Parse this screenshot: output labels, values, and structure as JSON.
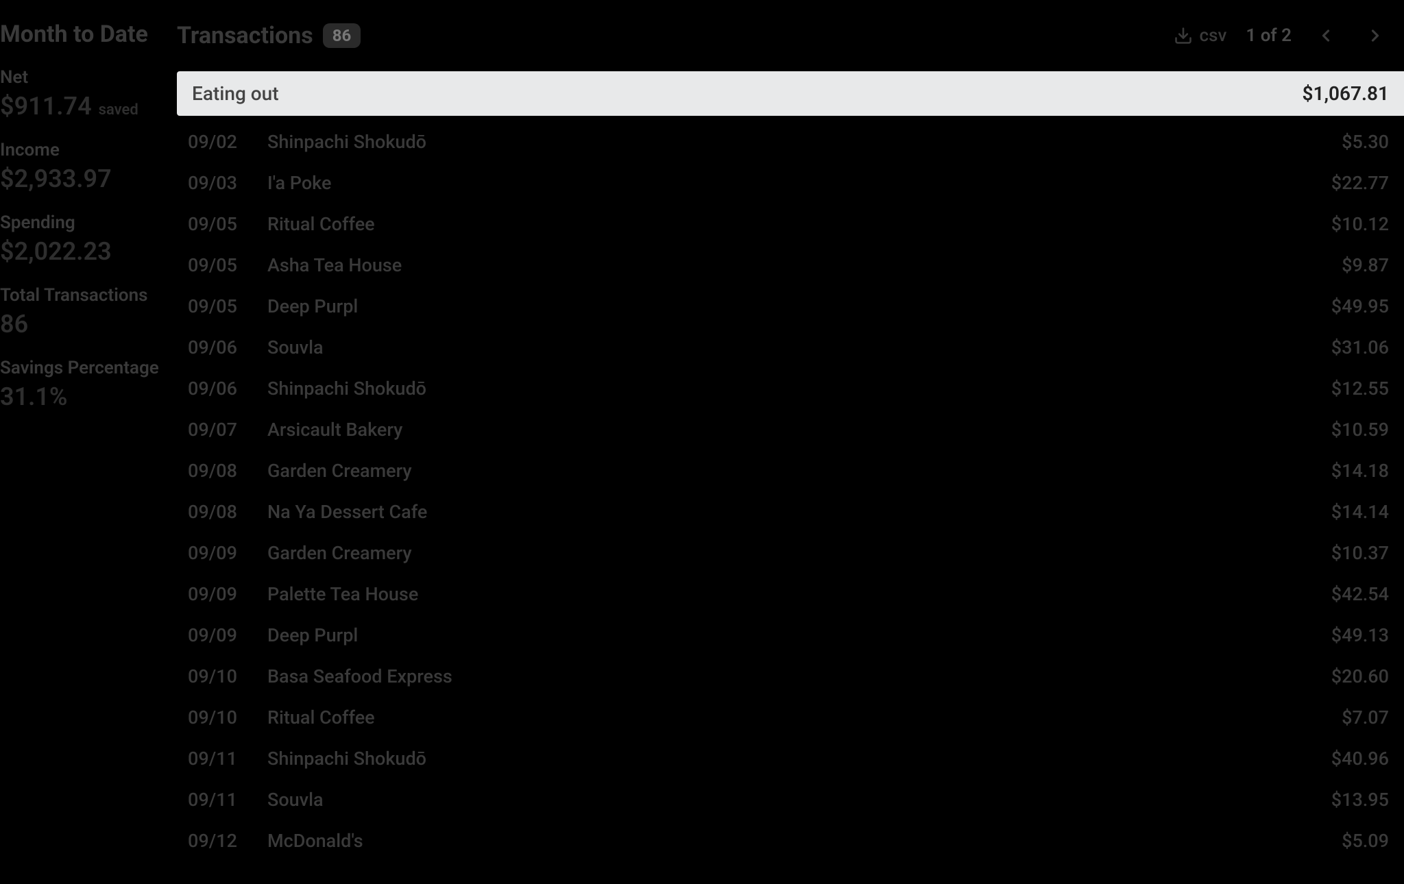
{
  "sidebar": {
    "title": "Month to Date",
    "stats": [
      {
        "label": "Net",
        "value": "$911.74",
        "suffix": "saved"
      },
      {
        "label": "Income",
        "value": "$2,933.97",
        "suffix": ""
      },
      {
        "label": "Spending",
        "value": "$2,022.23",
        "suffix": ""
      },
      {
        "label": "Total Transactions",
        "value": "86",
        "suffix": ""
      },
      {
        "label": "Savings Percentage",
        "value": "31.1%",
        "suffix": ""
      }
    ]
  },
  "header": {
    "title": "Transactions",
    "count": "86",
    "csv_label": "csv",
    "pager": "1 of 2"
  },
  "category": {
    "name": "Eating out",
    "total": "$1,067.81"
  },
  "transactions": [
    {
      "date": "09/02",
      "merchant": "Shinpachi Shokudō",
      "amount": "$5.30"
    },
    {
      "date": "09/03",
      "merchant": "I'a Poke",
      "amount": "$22.77"
    },
    {
      "date": "09/05",
      "merchant": "Ritual Coffee",
      "amount": "$10.12"
    },
    {
      "date": "09/05",
      "merchant": "Asha Tea House",
      "amount": "$9.87"
    },
    {
      "date": "09/05",
      "merchant": "Deep Purpl",
      "amount": "$49.95"
    },
    {
      "date": "09/06",
      "merchant": "Souvla",
      "amount": "$31.06"
    },
    {
      "date": "09/06",
      "merchant": "Shinpachi Shokudō",
      "amount": "$12.55"
    },
    {
      "date": "09/07",
      "merchant": "Arsicault Bakery",
      "amount": "$10.59"
    },
    {
      "date": "09/08",
      "merchant": "Garden Creamery",
      "amount": "$14.18"
    },
    {
      "date": "09/08",
      "merchant": "Na Ya Dessert Cafe",
      "amount": "$14.14"
    },
    {
      "date": "09/09",
      "merchant": "Garden Creamery",
      "amount": "$10.37"
    },
    {
      "date": "09/09",
      "merchant": "Palette Tea House",
      "amount": "$42.54"
    },
    {
      "date": "09/09",
      "merchant": "Deep Purpl",
      "amount": "$49.13"
    },
    {
      "date": "09/10",
      "merchant": "Basa Seafood Express",
      "amount": "$20.60"
    },
    {
      "date": "09/10",
      "merchant": "Ritual Coffee",
      "amount": "$7.07"
    },
    {
      "date": "09/11",
      "merchant": "Shinpachi Shokudō",
      "amount": "$40.96"
    },
    {
      "date": "09/11",
      "merchant": "Souvla",
      "amount": "$13.95"
    },
    {
      "date": "09/12",
      "merchant": "McDonald's",
      "amount": "$5.09"
    }
  ]
}
